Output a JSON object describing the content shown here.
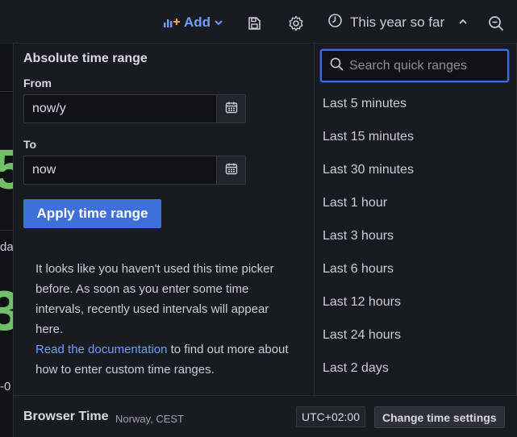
{
  "toolbar": {
    "add_label": "Add",
    "time_range_label": "This year so far"
  },
  "background": {
    "fragment_1": "5",
    "fragment_2": "3",
    "text_1": "da",
    "text_2": "-0"
  },
  "picker": {
    "title": "Absolute time range",
    "from_label": "From",
    "from_value": "now/y",
    "to_label": "To",
    "to_value": "now",
    "apply_label": "Apply time range",
    "help_text": "It looks like you haven't used this time picker before. As soon as you enter some time intervals, recently used intervals will appear here.",
    "help_link": "Read the documentation",
    "help_suffix": " to find out more about how to enter custom time ranges."
  },
  "quick_ranges": {
    "placeholder": "Search quick ranges",
    "items": [
      "Last 5 minutes",
      "Last 15 minutes",
      "Last 30 minutes",
      "Last 1 hour",
      "Last 3 hours",
      "Last 6 hours",
      "Last 12 hours",
      "Last 24 hours",
      "Last 2 days"
    ]
  },
  "footer": {
    "timezone_label": "Browser Time",
    "timezone_location": "Norway, CEST",
    "utc_offset": "UTC+02:00",
    "change_button": "Change time settings"
  },
  "colors": {
    "accent": "#3d71d9",
    "link": "#6e9fff",
    "stat_green": "#73bf69",
    "panel_bg": "#181b1f",
    "page_bg": "#111217"
  },
  "icons": {
    "add": "add-panel-icon",
    "add_chevron": "chevron-down-icon",
    "save": "save-icon",
    "settings": "gear-icon",
    "clock": "clock-icon",
    "range_chevron": "chevron-up-icon",
    "zoom": "zoom-out-icon",
    "calendar": "calendar-icon",
    "search": "search-icon"
  }
}
